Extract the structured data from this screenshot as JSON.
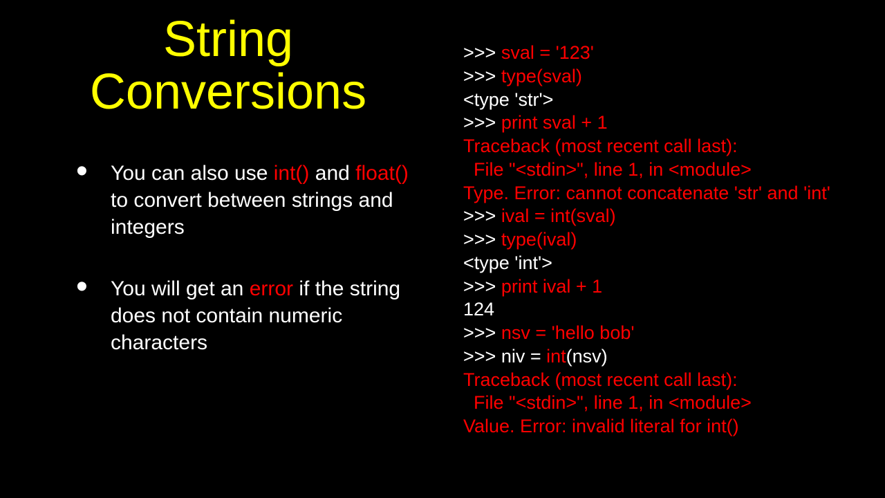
{
  "title": "String Conversions",
  "bullets": [
    {
      "pre": "You can also use ",
      "hl1": "int()",
      "mid": " and ",
      "hl2": "float()",
      "post": " to convert between strings and integers"
    },
    {
      "pre": "You will get an ",
      "hl1": "error",
      "mid": "",
      "hl2": "",
      "post": " if the string does not contain numeric characters"
    }
  ],
  "code": {
    "l1a": ">>> ",
    "l1b": "sval = '123'",
    "l2a": ">>> ",
    "l2b": "type(sval)",
    "l3": "<type 'str'>",
    "l4a": ">>> ",
    "l4b": "print sval + 1",
    "l5": "Traceback (most recent call last):",
    "l6": "  File \"<stdin>\", line 1, in <module>",
    "l7": "Type. Error: cannot concatenate 'str' and 'int'",
    "l8a": ">>> ",
    "l8b": "ival = int(sval)",
    "l9a": ">>> ",
    "l9b": "type(ival)",
    "l10": "<type 'int'>",
    "l11a": ">>> ",
    "l11b": "print ival + 1",
    "l12": "124",
    "l13a": ">>> ",
    "l13b": "nsv = 'hello bob'",
    "l14a": ">>> ",
    "l14b": "niv = ",
    "l14c": "int",
    "l14d": "(nsv)",
    "l15": "Traceback (most recent call last):",
    "l16": "  File \"<stdin>\", line 1, in <module>",
    "l17": "Value. Error: invalid literal for int()"
  }
}
